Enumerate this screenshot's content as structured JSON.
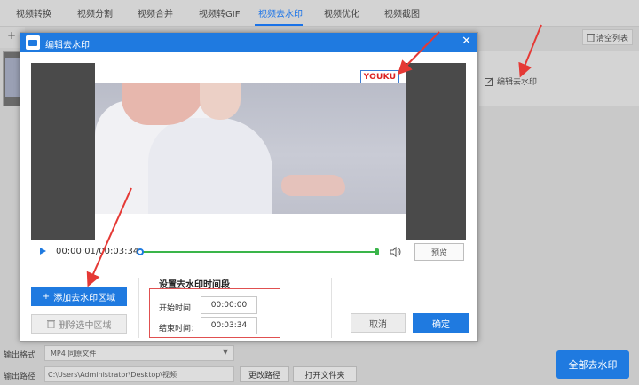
{
  "app": {
    "tabs": [
      {
        "label": "视频转换",
        "active": false
      },
      {
        "label": "视频分割",
        "active": false
      },
      {
        "label": "视频合并",
        "active": false
      },
      {
        "label": "视频转GIF",
        "active": false
      },
      {
        "label": "视频去水印",
        "active": true
      },
      {
        "label": "视频优化",
        "active": false
      },
      {
        "label": "视频截图",
        "active": false
      }
    ],
    "add_symbol": "+",
    "clear_list_label": "清空列表",
    "edit_watermark_link": "编辑去水印",
    "output_format_label": "输出格式",
    "output_format_value": "MP4  同原文件",
    "output_path_label": "输出路径",
    "output_path_value": "C:\\Users\\Administrator\\Desktop\\视频",
    "change_path_label": "更改路径",
    "open_folder_label": "打开文件夹",
    "remove_all_label": "全部去水印",
    "accent_color": "#1f7ae0"
  },
  "dialog": {
    "title": "编辑去水印",
    "close_symbol": "✕",
    "watermark_text": "YOUKU",
    "player": {
      "time": "00:00:01/00:03:34",
      "preview_label": "预览"
    },
    "add_region_label": "添加去水印区域",
    "delete_region_label": "删除选中区域",
    "time_section": {
      "title": "设置去水印时间段",
      "start_label": "开始时间",
      "start_value": "00:00:00",
      "end_label": "结束时间：",
      "end_value": "00:03:34"
    },
    "cancel_label": "取消",
    "ok_label": "确定"
  },
  "annotation_color": "#e53935"
}
